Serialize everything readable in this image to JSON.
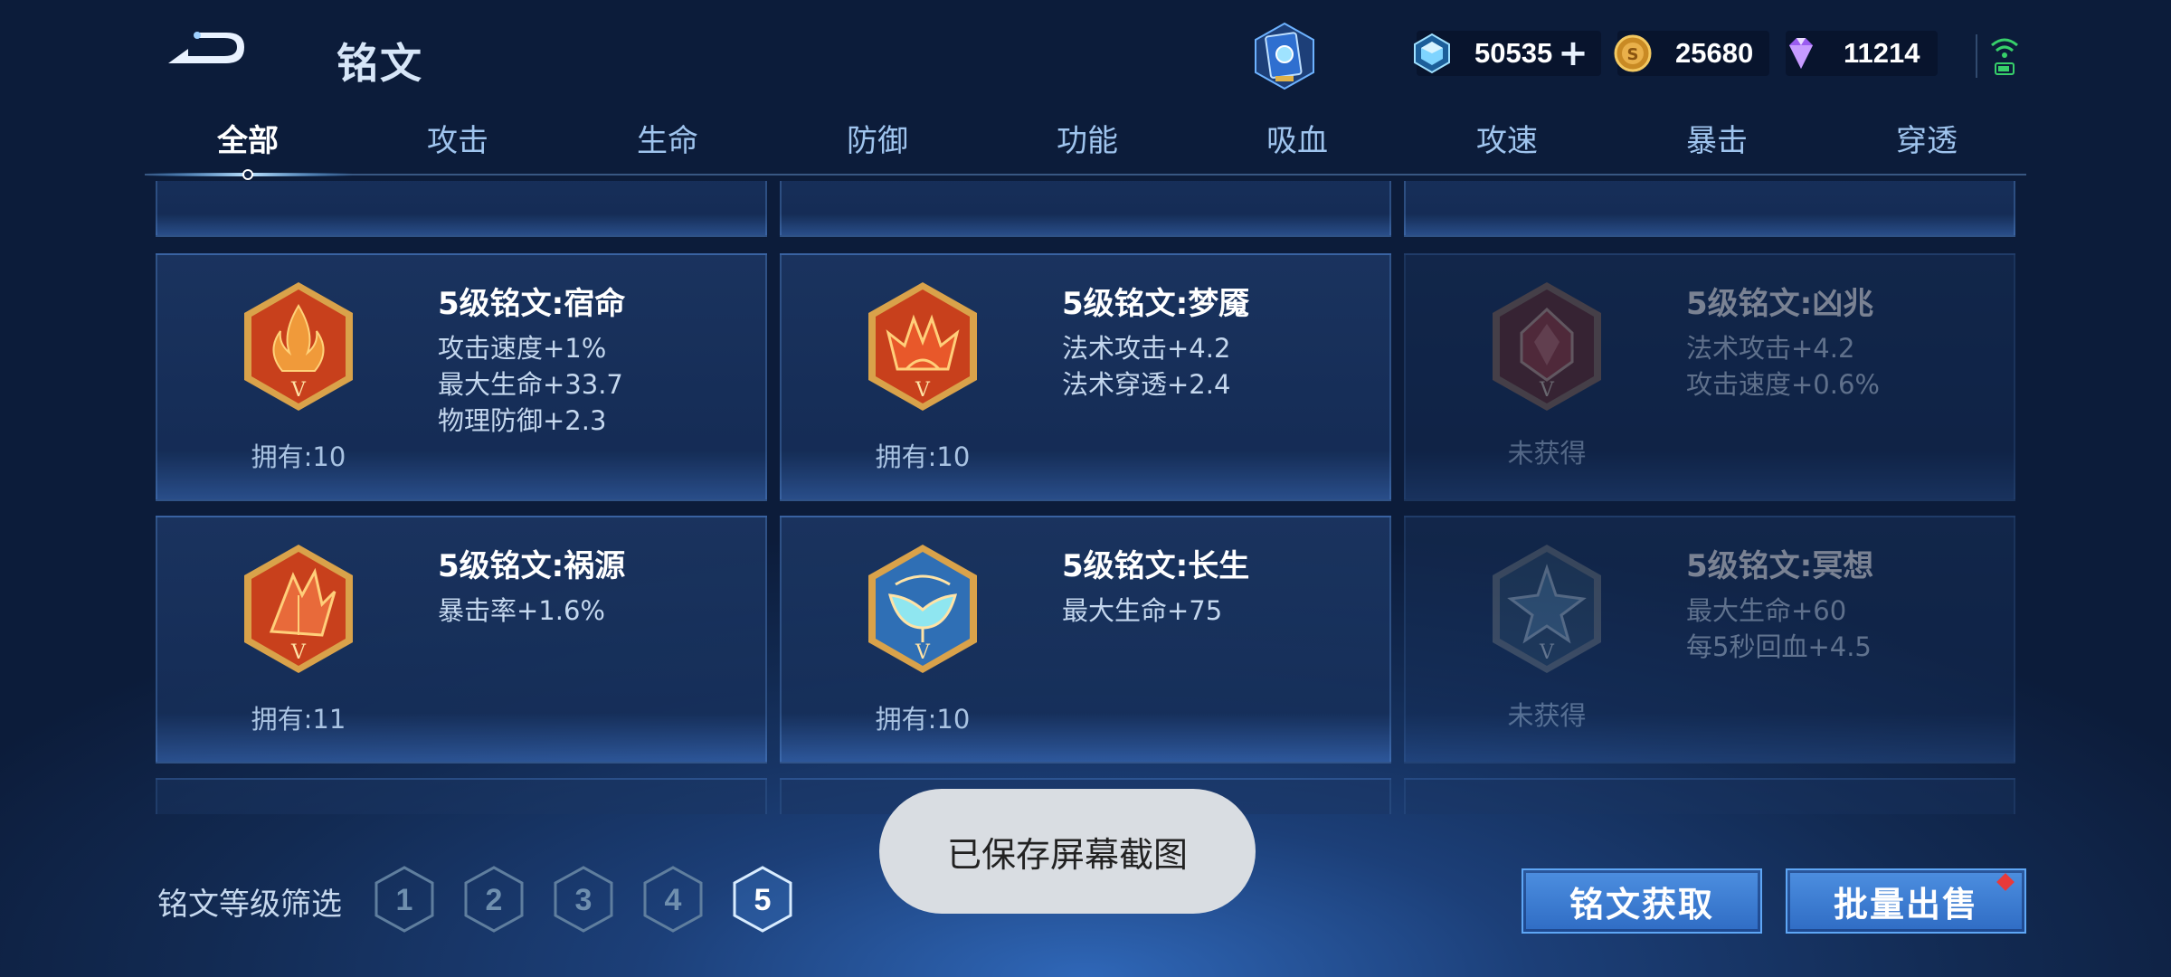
{
  "header": {
    "title": "铭文",
    "resources": [
      {
        "name": "diamond",
        "value": "50535",
        "has_plus": true,
        "color": "#7fd0ff"
      },
      {
        "name": "gold-coin",
        "value": "25680",
        "has_plus": false,
        "color": "#e0a93a"
      },
      {
        "name": "purple-gem",
        "value": "11214",
        "has_plus": false,
        "color": "#b77cff"
      }
    ]
  },
  "tabs": [
    {
      "label": "全部",
      "active": true
    },
    {
      "label": "攻击"
    },
    {
      "label": "生命"
    },
    {
      "label": "防御"
    },
    {
      "label": "功能"
    },
    {
      "label": "吸血"
    },
    {
      "label": "攻速"
    },
    {
      "label": "暴击"
    },
    {
      "label": "穿透"
    }
  ],
  "cards": [
    {
      "name": "5级铭文:宿命",
      "stats": [
        "攻击速度+1%",
        "最大生命+33.7",
        "物理防御+2.3"
      ],
      "owned": "拥有:10",
      "acquired": true,
      "color": "red",
      "emblem": "flame-emblem-icon"
    },
    {
      "name": "5级铭文:梦魇",
      "stats": [
        "法术攻击+4.2",
        "法术穿透+2.4"
      ],
      "owned": "拥有:10",
      "acquired": true,
      "color": "red",
      "emblem": "crown-emblem-icon"
    },
    {
      "name": "5级铭文:凶兆",
      "stats": [
        "法术攻击+4.2",
        "攻击速度+0.6%"
      ],
      "owned": "未获得",
      "acquired": false,
      "color": "red",
      "emblem": "gem-emblem-icon"
    },
    {
      "name": "5级铭文:祸源",
      "stats": [
        "暴击率+1.6%"
      ],
      "owned": "拥有:11",
      "acquired": true,
      "color": "red",
      "emblem": "fan-emblem-icon"
    },
    {
      "name": "5级铭文:长生",
      "stats": [
        "最大生命+75"
      ],
      "owned": "拥有:10",
      "acquired": true,
      "color": "blue",
      "emblem": "wings-emblem-icon"
    },
    {
      "name": "5级铭文:冥想",
      "stats": [
        "最大生命+60",
        "每5秒回血+4.5"
      ],
      "owned": "未获得",
      "acquired": false,
      "color": "blue",
      "emblem": "star-emblem-icon"
    }
  ],
  "bottom": {
    "filter_label": "铭文等级筛选",
    "levels": [
      "1",
      "2",
      "3",
      "4",
      "5"
    ],
    "selected_level": "5",
    "toast": "已保存屏幕截图",
    "obtain_button": "铭文获取",
    "bulk_sell_button": "批量出售"
  },
  "colors": {
    "accent": "#3a7bd5",
    "tab_active": "#ffffff",
    "tab_inactive": "#9fc4ee",
    "red_emblem": "#c8401c",
    "blue_emblem": "#2f6fb5",
    "gold_frame": "#d9a24a"
  }
}
